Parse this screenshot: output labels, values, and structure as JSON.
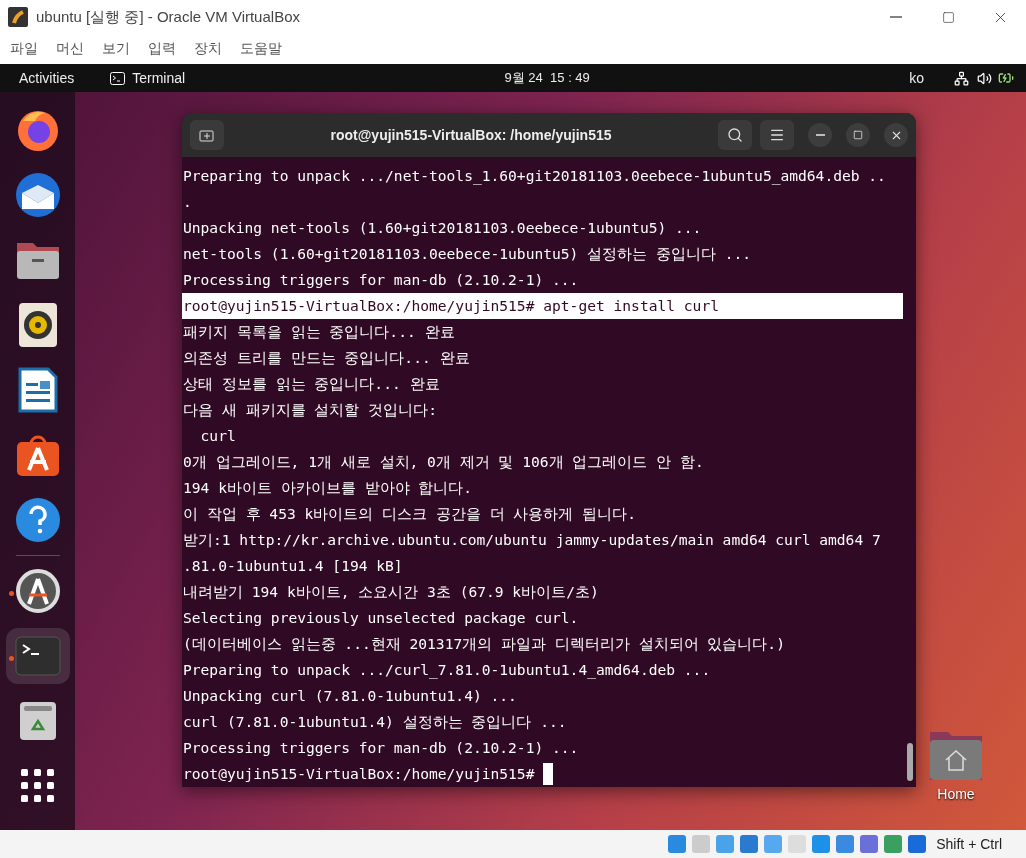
{
  "window": {
    "title": "ubuntu [실행 중] - Oracle VM VirtualBox"
  },
  "menu": [
    "파일",
    "머신",
    "보기",
    "입력",
    "장치",
    "도움말"
  ],
  "top_bar": {
    "activities": "Activities",
    "app": "Terminal",
    "clock": "9월 24  15 : 49",
    "input_method": "ko"
  },
  "dock": [
    {
      "kind": "firefox",
      "running": false,
      "selected": false
    },
    {
      "kind": "thunderbird",
      "running": false,
      "selected": false
    },
    {
      "kind": "files",
      "running": false,
      "selected": false
    },
    {
      "kind": "rhythmbox",
      "running": false,
      "selected": false
    },
    {
      "kind": "writer",
      "running": false,
      "selected": false
    },
    {
      "kind": "software",
      "running": false,
      "selected": false
    },
    {
      "kind": "help",
      "running": false,
      "selected": false
    },
    {
      "kind": "separator"
    },
    {
      "kind": "updater",
      "running": true,
      "selected": false
    },
    {
      "kind": "terminal",
      "running": true,
      "selected": true
    },
    {
      "kind": "trash",
      "running": false,
      "selected": false
    },
    {
      "kind": "apps",
      "running": false,
      "selected": false
    }
  ],
  "terminal": {
    "title": "root@yujin515-VirtualBox: /home/yujin515",
    "lines": [
      {
        "text": "Preparing to unpack .../net-tools_1.60+git20181103.0eebece-1ubuntu5_amd64.deb ..",
        "highlighted": false
      },
      {
        "text": ".",
        "highlighted": false
      },
      {
        "text": "Unpacking net-tools (1.60+git20181103.0eebece-1ubuntu5) ...",
        "highlighted": false
      },
      {
        "text": "net-tools (1.60+git20181103.0eebece-1ubuntu5) 설정하는 중입니다 ...",
        "highlighted": false
      },
      {
        "text": "Processing triggers for man-db (2.10.2-1) ...",
        "highlighted": false
      },
      {
        "text": "root@yujin515-VirtualBox:/home/yujin515# apt-get install curl",
        "highlighted": true
      },
      {
        "text": "패키지 목록을 읽는 중입니다... 완료",
        "highlighted": false
      },
      {
        "text": "의존성 트리를 만드는 중입니다... 완료",
        "highlighted": false
      },
      {
        "text": "상태 정보를 읽는 중입니다... 완료",
        "highlighted": false
      },
      {
        "text": "다음 새 패키지를 설치할 것입니다:",
        "highlighted": false
      },
      {
        "text": "  curl",
        "highlighted": false
      },
      {
        "text": "0개 업그레이드, 1개 새로 설치, 0개 제거 및 106개 업그레이드 안 함.",
        "highlighted": false
      },
      {
        "text": "194 k바이트 아카이브를 받아야 합니다.",
        "highlighted": false
      },
      {
        "text": "이 작업 후 453 k바이트의 디스크 공간을 더 사용하게 됩니다.",
        "highlighted": false
      },
      {
        "text": "받기:1 http://kr.archive.ubuntu.com/ubuntu jammy-updates/main amd64 curl amd64 7",
        "highlighted": false
      },
      {
        "text": ".81.0-1ubuntu1.4 [194 kB]",
        "highlighted": false
      },
      {
        "text": "내려받기 194 k바이트, 소요시간 3초 (67.9 k바이트/초)",
        "highlighted": false
      },
      {
        "text": "Selecting previously unselected package curl.",
        "highlighted": false
      },
      {
        "text": "(데이터베이스 읽는중 ...현재 201317개의 파일과 디렉터리가 설치되어 있습니다.)",
        "highlighted": false
      },
      {
        "text": "Preparing to unpack .../curl_7.81.0-1ubuntu1.4_amd64.deb ...",
        "highlighted": false
      },
      {
        "text": "Unpacking curl (7.81.0-1ubuntu1.4) ...",
        "highlighted": false
      },
      {
        "text": "curl (7.81.0-1ubuntu1.4) 설정하는 중입니다 ...",
        "highlighted": false
      },
      {
        "text": "Processing triggers for man-db (2.10.2-1) ...",
        "highlighted": false
      }
    ],
    "prompt": "root@yujin515-VirtualBox:/home/yujin515#"
  },
  "desktop_icons": [
    {
      "label": "Home"
    }
  ],
  "status_bar": {
    "host_key": "Shift + Ctrl"
  }
}
